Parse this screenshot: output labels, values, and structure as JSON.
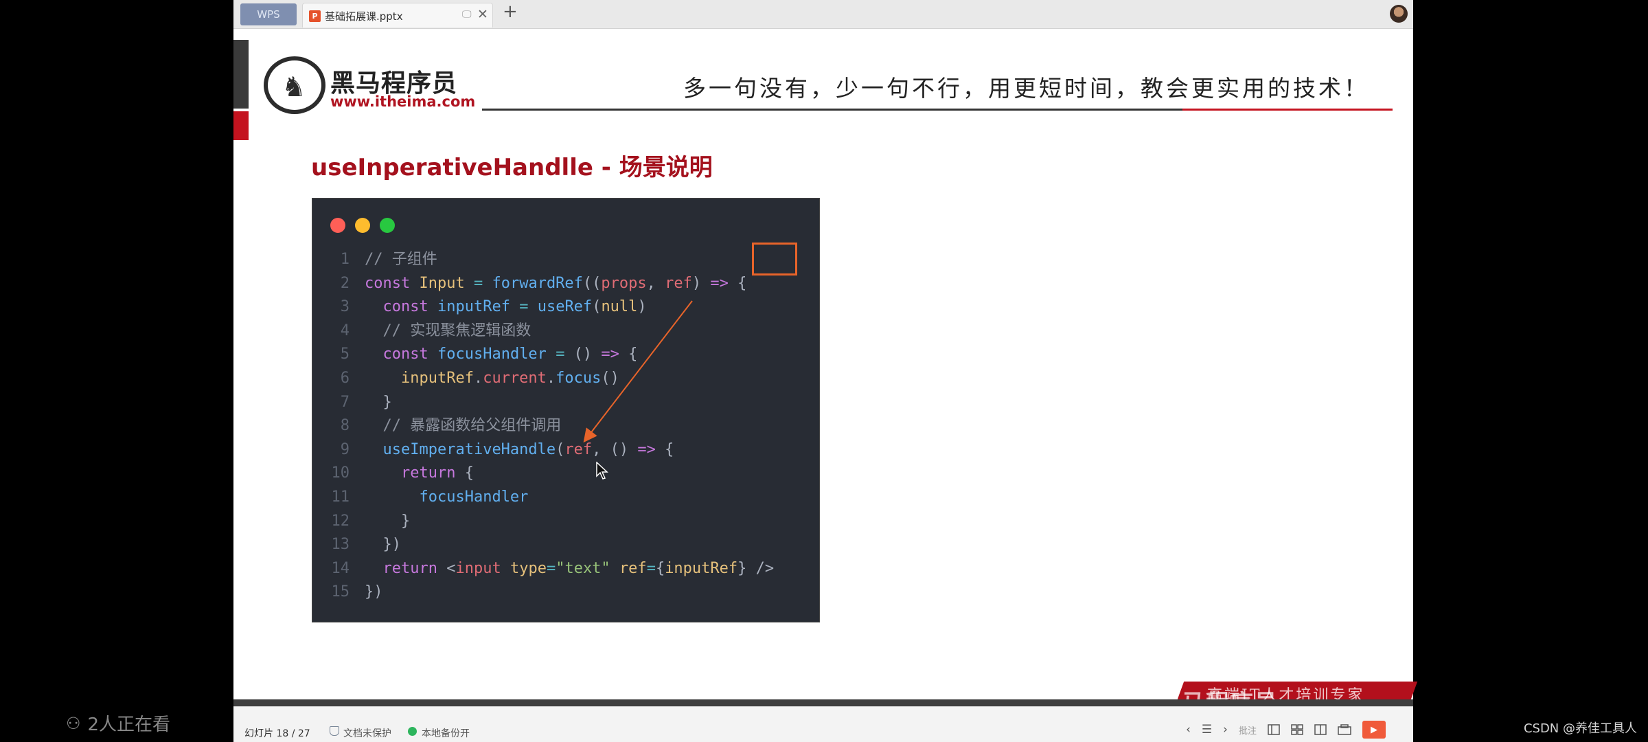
{
  "tabs": {
    "wps_label": "WPS",
    "doc_title": "基础拓展课.pptx",
    "monitor_glyph": "🖵",
    "close_glyph": "✕",
    "add_glyph": "+"
  },
  "slide": {
    "logo_name": "黑马程序员",
    "logo_url": "www.itheima.com",
    "slogan": "多一句没有，少一句不行，用更短时间，教会更实用的技术！",
    "title": "useInperativeHandlle - 场景说明",
    "watermark_band": "高端IT人才培训专家",
    "watermark_logo": "黑马程序员"
  },
  "code_lines": [
    {
      "n": "1",
      "html": "<span class='tok-comment'>// 子组件</span>"
    },
    {
      "n": "2",
      "html": "<span class='tok-kw'>const</span> <span class='tok-var'>Input</span> <span class='tok-op'>=</span> <span class='tok-fn'>forwardRef</span>((<span class='tok-prop'>props</span>, <span class='tok-prop'>ref</span>) <span class='tok-kw'>=></span> {"
    },
    {
      "n": "3",
      "html": "  <span class='tok-kw'>const</span> <span class='tok-fn'>inputRef</span> <span class='tok-op'>=</span> <span class='tok-fn'>useRef</span>(<span class='tok-var'>null</span>)"
    },
    {
      "n": "4",
      "html": "  <span class='tok-comment'>// 实现聚焦逻辑函数</span>"
    },
    {
      "n": "5",
      "html": "  <span class='tok-kw'>const</span> <span class='tok-fn'>focusHandler</span> <span class='tok-op'>=</span> () <span class='tok-kw'>=></span> {"
    },
    {
      "n": "6",
      "html": "    <span class='tok-var'>inputRef</span>.<span class='tok-prop'>current</span>.<span class='tok-fn'>focus</span>()"
    },
    {
      "n": "7",
      "html": "  }"
    },
    {
      "n": "8",
      "html": "  <span class='tok-comment'>// 暴露函数给父组件调用</span>"
    },
    {
      "n": "9",
      "html": "  <span class='tok-fn'>useImperativeHandle</span>(<span class='tok-prop'>ref</span>, () <span class='tok-kw'>=></span> {"
    },
    {
      "n": "10",
      "html": "    <span class='tok-kw'>return</span> {"
    },
    {
      "n": "11",
      "html": "      <span class='tok-fn'>focusHandler</span>"
    },
    {
      "n": "12",
      "html": "    }"
    },
    {
      "n": "13",
      "html": "  })"
    },
    {
      "n": "14",
      "html": "  <span class='tok-kw'>return</span> &lt;<span class='tok-prop'>input</span> <span class='tok-var'>type</span><span class='tok-op'>=</span><span class='tok-str'>\"text\"</span> <span class='tok-var'>ref</span><span class='tok-op'>=</span>{<span class='tok-var'>inputRef</span>} /&gt;"
    },
    {
      "n": "15",
      "html": "})"
    }
  ],
  "statusbar": {
    "slide_counter": "幻灯片 18 / 27",
    "protect": "文档未保护",
    "backup": "本地备份开",
    "prev": "‹",
    "outline": "☰",
    "next": "›",
    "comment": "批注",
    "play": "▶"
  },
  "overlay": {
    "viewers_icon": "⚇",
    "viewers": "2人正在看",
    "csdn": "CSDN @养佳工具人"
  },
  "colors": {
    "brand_red": "#c4131f",
    "code_bg": "#282c34",
    "highlight_box": "#e8642a"
  }
}
